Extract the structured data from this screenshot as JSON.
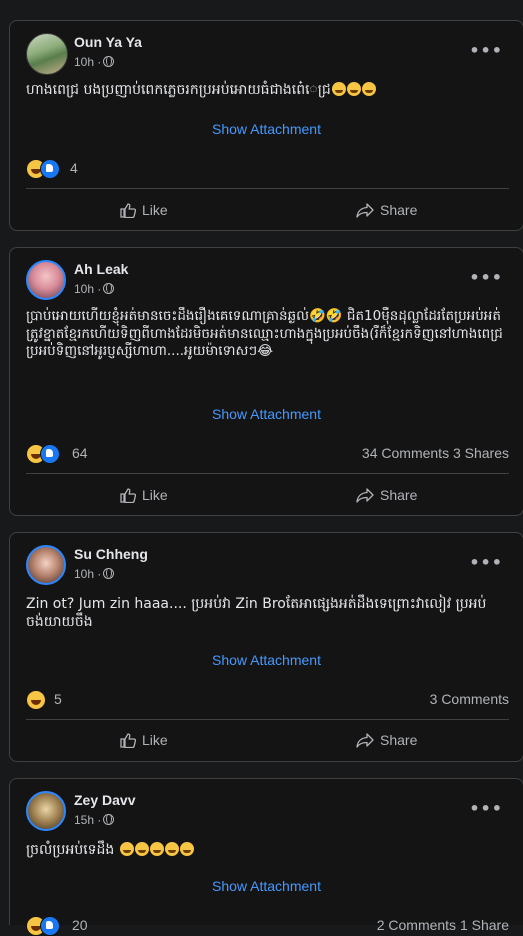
{
  "colors": {
    "background": "#18191a",
    "card": "#141414",
    "link": "#4599ff",
    "muted": "#b0b3b8"
  },
  "labels": {
    "show_attachment": "Show Attachment",
    "like": "Like",
    "share": "Share"
  },
  "posts": [
    {
      "author": "Oun Ya Ya",
      "time": "10h ·",
      "text": "ហាងពេជ្រ បងប្រញាប់ពេកភ្លេចរកប្រអប់អោយធំជាងពេ៎េជ្រ",
      "reaction_count": "4",
      "stats": ""
    },
    {
      "author": "Ah Leak",
      "time": "10h ·",
      "text": "ប្រាប់អោយហើយខ្ញុំអត់មានចេះដឹងរឿងគេទេណាគ្រាន់ឆ្ងល់🤣🤣 ជិត10ម៉ឺនដុល្លាដែរតែប្រអប់អត់ត្រូវខ្នាតខ្មែរកហើយទិញពីហាងដែរមិចអត់មានឈ្មោះហាងក្នុងប្រអប់ចឹង(រឺក៏ខ្មែរកទិញនៅហាងពេជ្រប្រអប់ទិញនៅអូរប្ញស្សីហាហា....អូយម៉ាទោសៗ😂",
      "reaction_count": "64",
      "stats": "34 Comments  3 Shares"
    },
    {
      "author": "Su Chheng",
      "time": "10h ·",
      "text": "Zin ot? Jum zin haaa.... ប្រអប់វា Zin Broតែអាផ្សេងអត់ដឹងទេព្រោះវាលៀវ ប្រអប់ ចង់យាយចឹង",
      "reaction_count": "5",
      "stats": "3 Comments"
    },
    {
      "author": "Zey Davv",
      "time": "15h ·",
      "text": "ច្រលំប្រអប់ទេដឹង",
      "reaction_count": "20",
      "stats": "2 Comments  1 Share"
    }
  ]
}
